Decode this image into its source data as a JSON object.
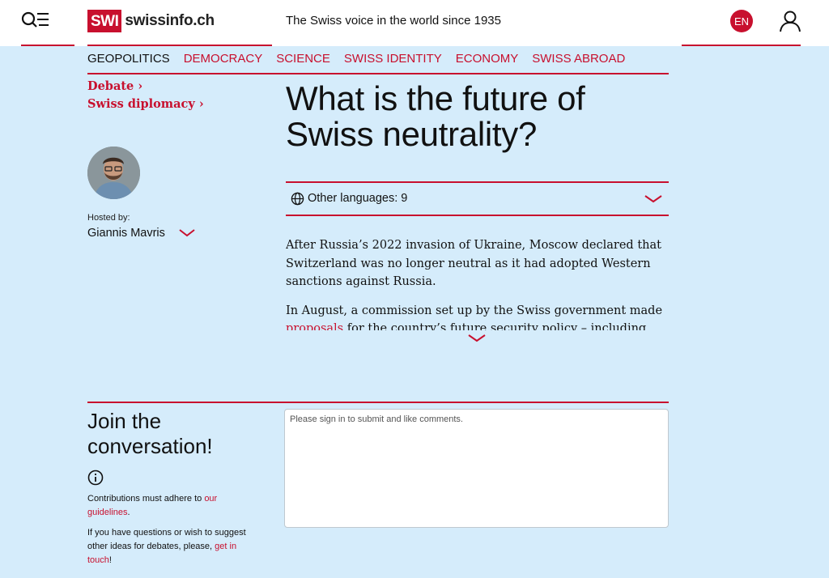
{
  "header": {
    "logo_mark": "SWI",
    "logo_text": "swissinfo.ch",
    "tagline": "The Swiss voice in the world since 1935",
    "language": "EN",
    "accent_color": "#c8102e"
  },
  "nav": {
    "items": [
      "GEOPOLITICS",
      "DEMOCRACY",
      "SCIENCE",
      "SWISS IDENTITY",
      "ECONOMY",
      "SWISS ABROAD"
    ]
  },
  "sidebar": {
    "links": [
      "Debate",
      "Swiss diplomacy"
    ],
    "hosted_label": "Hosted by:",
    "host_name": "Giannis Mavris"
  },
  "article": {
    "title": "What is the future of Swiss neutrality?",
    "languages_label": "Other languages: 9",
    "paragraph1": "After Russia’s 2022 invasion of Ukraine, Moscow declared that Switzerland was no longer neutral as it had adopted Western sanctions against Russia.",
    "paragraph2_before": "In August, a commission set up by the Swiss government made ",
    "paragraph2_link": "proposals",
    "paragraph2_after": " for the country’s future security policy – including"
  },
  "conversation": {
    "title": "Join the conversation!",
    "note1_before": "Contributions must adhere to ",
    "note1_link": "our guidelines",
    "note1_after": ".",
    "note2_before": "If you have questions or wish to suggest other ideas for debates, please, ",
    "note2_link": "get in touch",
    "note2_after": "!",
    "comment_placeholder": "Please sign in to submit and like comments."
  }
}
